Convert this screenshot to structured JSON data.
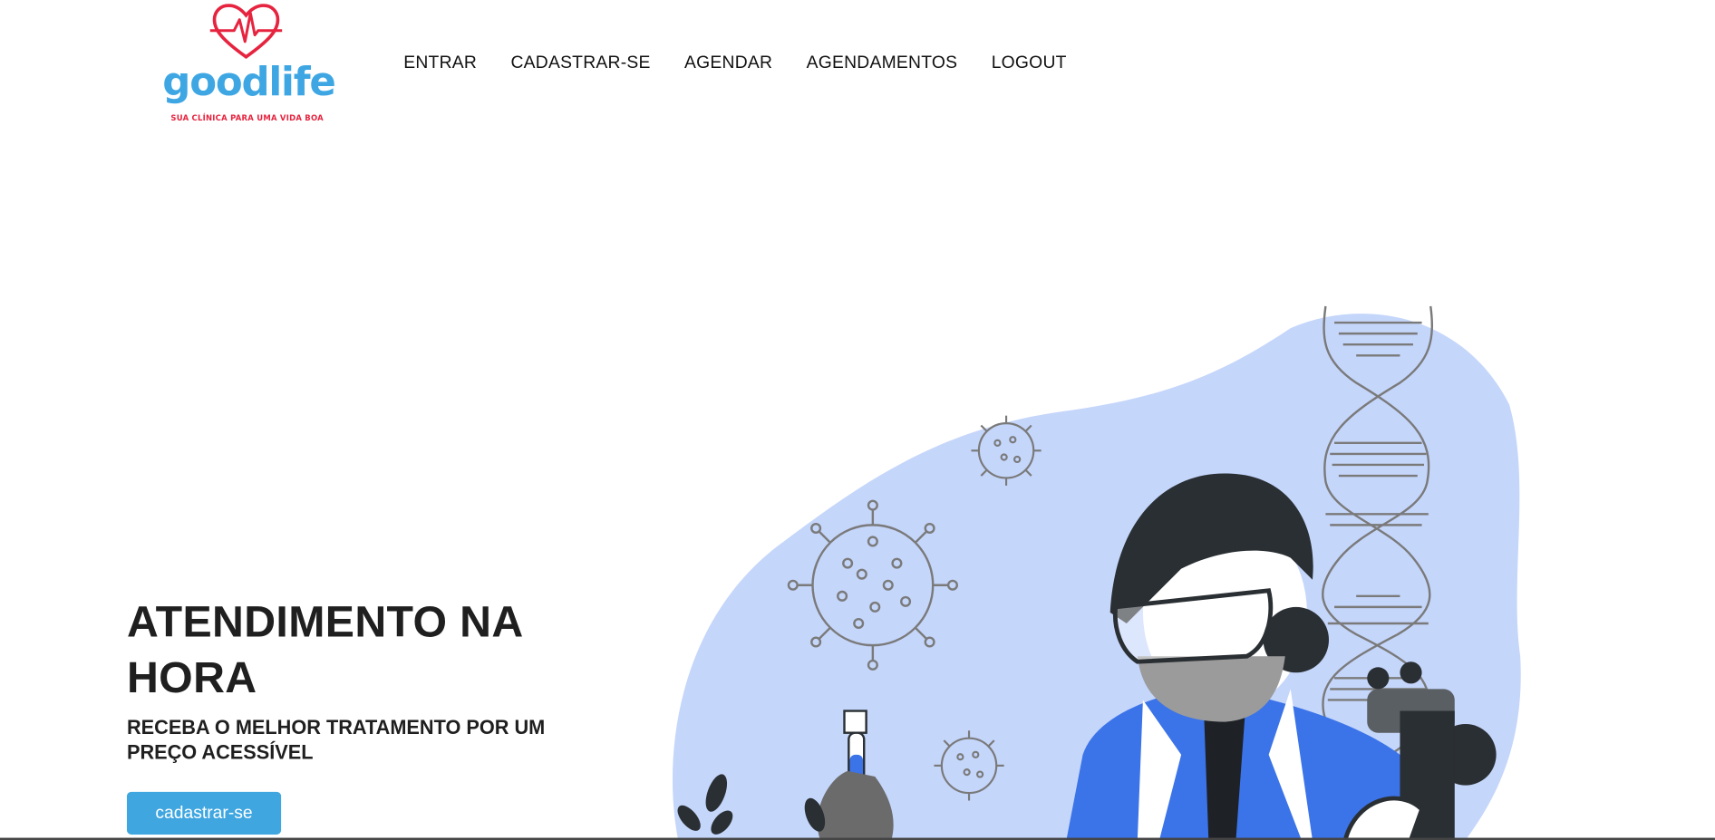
{
  "brand": {
    "logo_text": "goodlife",
    "tagline": "SUA CLÍNICA PARA UMA VIDA BOA",
    "colors": {
      "primary": "#3ea7e3",
      "accent": "#e6243f"
    }
  },
  "nav": {
    "items": [
      {
        "label": "ENTRAR"
      },
      {
        "label": "CADASTRAR-SE"
      },
      {
        "label": "AGENDAR"
      },
      {
        "label": "AGENDAMENTOS"
      },
      {
        "label": "LOGOUT"
      }
    ]
  },
  "hero": {
    "title": "ATENDIMENTO NA HORA",
    "subtitle": "RECEBA O MELHOR TRATAMENTO POR UM PREÇO ACESSÍVEL",
    "cta_label": "cadastrar-se",
    "cta_color": "#3fa6e0",
    "illustration_bg": "#c5d6fb"
  }
}
